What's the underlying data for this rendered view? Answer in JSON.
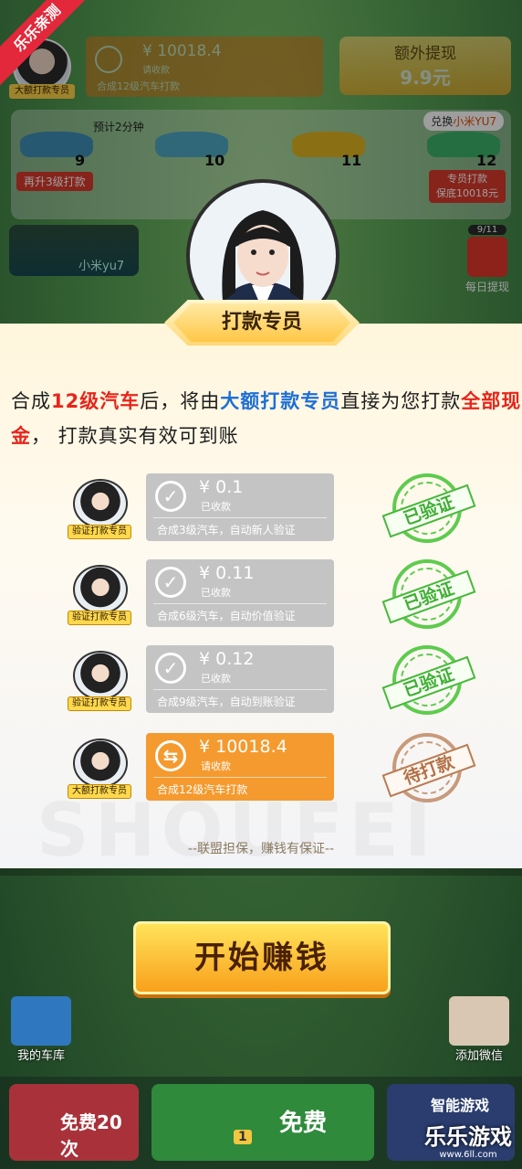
{
  "corner_ribbon": "乐乐亲测",
  "top": {
    "avatar_label": "大额打款专员",
    "pay_amount": "¥ 10018.4",
    "pay_status": "请收款",
    "pay_desc": "合成12级汽车打款",
    "extra_title": "额外提现",
    "extra_amount": "9.9元"
  },
  "progress": {
    "estimate": "预计2分钟",
    "redeem_prefix": "兑换",
    "redeem_target": "小米YU7",
    "levels": [
      "9",
      "10",
      "11",
      "12"
    ],
    "upgrade_label": "再升3级打款",
    "agent_label_1": "专员打款",
    "agent_label_2": "保底10018元"
  },
  "promo": {
    "car_label": "小米yu7"
  },
  "daily": {
    "count": "9/11",
    "label": "每日提现"
  },
  "modal": {
    "title": "打款专员",
    "intro": {
      "p1": "合成",
      "h1": "12级汽车",
      "p2": "后，将由",
      "h2": "大额打款专员",
      "p3": "直接为您打款",
      "h3": "全部现金",
      "p4": "， 打款真实有效可到账"
    },
    "rows": [
      {
        "agent": "验证打款专员",
        "amount": "¥ 0.1",
        "status": "已收款",
        "desc": "合成3级汽车，自动新人验证",
        "stamp": "已验证",
        "state": "done"
      },
      {
        "agent": "验证打款专员",
        "amount": "¥ 0.11",
        "status": "已收款",
        "desc": "合成6级汽车，自动价值验证",
        "stamp": "已验证",
        "state": "done"
      },
      {
        "agent": "验证打款专员",
        "amount": "¥ 0.12",
        "status": "已收款",
        "desc": "合成9级汽车，自动到账验证",
        "stamp": "已验证",
        "state": "done"
      },
      {
        "agent": "大额打款专员",
        "amount": "¥ 10018.4",
        "status": "请收款",
        "desc": "合成12级汽车打款",
        "stamp": "待打款",
        "state": "pending"
      }
    ],
    "guarantee": "--联盟担保，赚钱有保证--",
    "watermark": "SHOUFEI"
  },
  "start_button": "开始赚钱",
  "side": {
    "garage": "我的车库",
    "wechat": "添加微信"
  },
  "bottom": {
    "left": "免费20次",
    "middle": "免费",
    "middle_count": "1",
    "right": "智能游戏"
  },
  "logo": {
    "title": "乐乐游戏",
    "url": "www.6ll.com"
  }
}
